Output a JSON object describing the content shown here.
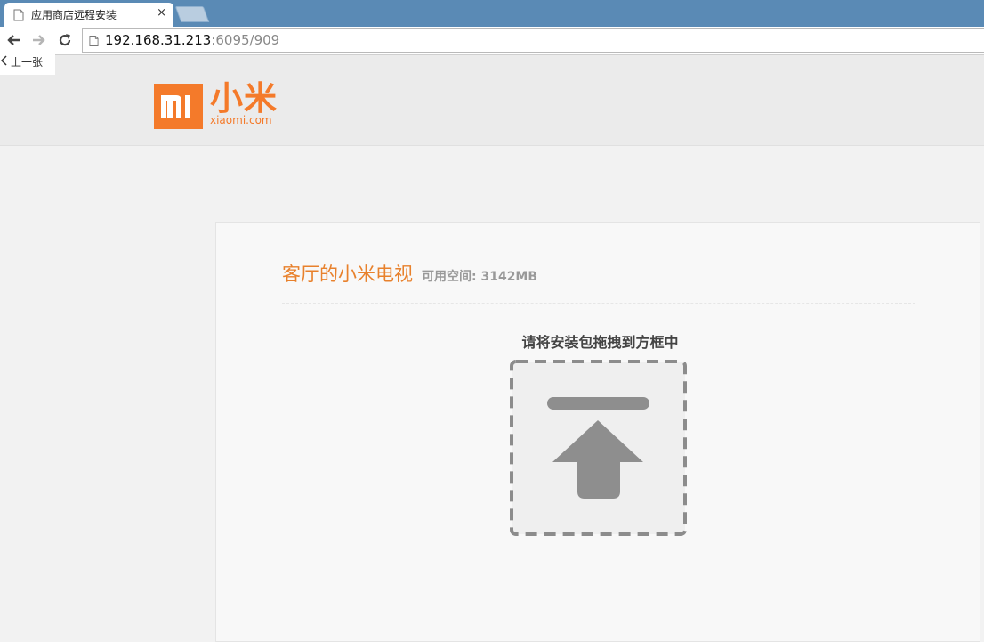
{
  "browser": {
    "tab": {
      "title": "应用商店远程安装",
      "close_label": "×"
    },
    "address": {
      "host": "192.168.31.213",
      "rest": ":6095/909"
    }
  },
  "page": {
    "prev_link": "上一张",
    "logo": {
      "cn": "小米",
      "en": "xiaomi.com"
    },
    "device_name": "客厅的小米电视",
    "space_label": "可用空间: 3142MB",
    "drop_hint": "请将安装包拖拽到方框中"
  },
  "colors": {
    "brand_orange": "#f47a2a",
    "title_orange": "#e8812c",
    "tab_strip": "#5a8ab5",
    "dropzone_border": "#8c8c8c"
  },
  "icons": [
    "back-icon",
    "forward-icon",
    "reload-icon",
    "page-icon",
    "upload-icon"
  ]
}
